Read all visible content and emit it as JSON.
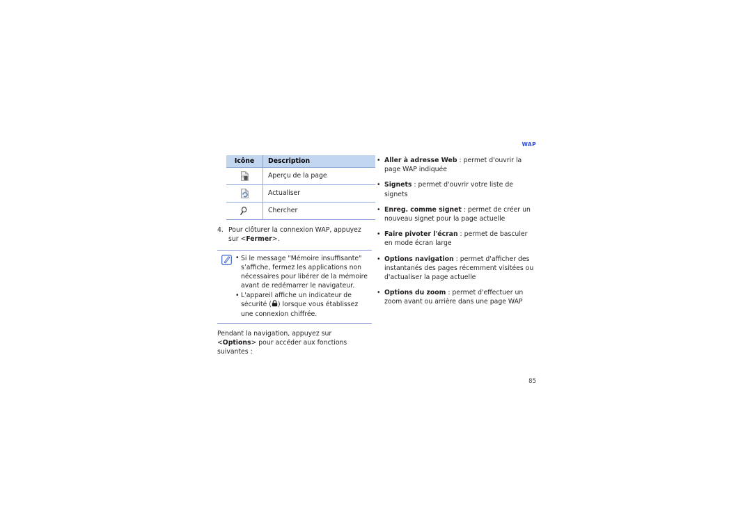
{
  "running_head": "WAP",
  "folio": "85",
  "colors": {
    "header_blue": "#2c4ae0",
    "table_header_bg": "#c2d6ef",
    "table_rule": "#8ea8de",
    "note_rule": "#8590d8",
    "text": "#231f20"
  },
  "table": {
    "columns": [
      "Icône",
      "Description"
    ],
    "rows": [
      {
        "icon": "page-preview-icon",
        "description": "Aperçu de la page"
      },
      {
        "icon": "refresh-page-icon",
        "description": "Actualiser"
      },
      {
        "icon": "search-magnifier-icon",
        "description": "Chercher"
      }
    ]
  },
  "step": {
    "number": "4.",
    "text_before": "Pour clôturer la connexion WAP, appuyez sur <",
    "bold": "Fermer",
    "text_after": ">."
  },
  "note": {
    "icon": "note-pencil-icon",
    "items": [
      {
        "bullet": "•",
        "text": "Si le message \"Mémoire insuffisante\" s’affiche, fermez les applications non nécessaires pour libérer de la mémoire avant de redémarrer le navigateur."
      },
      {
        "bullet": "•",
        "text_before": "L'appareil affiche un indicateur de sécurité (",
        "icon": "padlock-icon",
        "text_after": ") lorsque vous établissez une connexion chiffrée."
      }
    ]
  },
  "after_note": {
    "text_before": "Pendant la navigation, appuyez sur <",
    "bold": "Options",
    "text_after": "> pour accéder aux fonctions suivantes :"
  },
  "options_list": {
    "bullet": "•",
    "items": [
      {
        "term": "Aller à adresse Web",
        "sep": " : ",
        "desc": "permet d'ouvrir la page WAP indiquée"
      },
      {
        "term": "Signets",
        "sep": " : ",
        "desc": "permet d'ouvrir votre liste de signets"
      },
      {
        "term": "Enreg. comme signet",
        "sep": " : ",
        "desc": "permet de créer un nouveau signet pour la page actuelle"
      },
      {
        "term": "Faire pivoter l'écran",
        "sep": " : ",
        "desc": "permet de basculer en mode écran large"
      },
      {
        "term": "Options navigation",
        "sep": " : ",
        "desc": "permet d'afficher des instantanés des pages récemment visitées ou d'actualiser la page actuelle"
      },
      {
        "term": "Options du zoom",
        "sep": " : ",
        "desc": "permet d'effectuer un zoom avant ou arrière dans une page WAP"
      }
    ]
  }
}
